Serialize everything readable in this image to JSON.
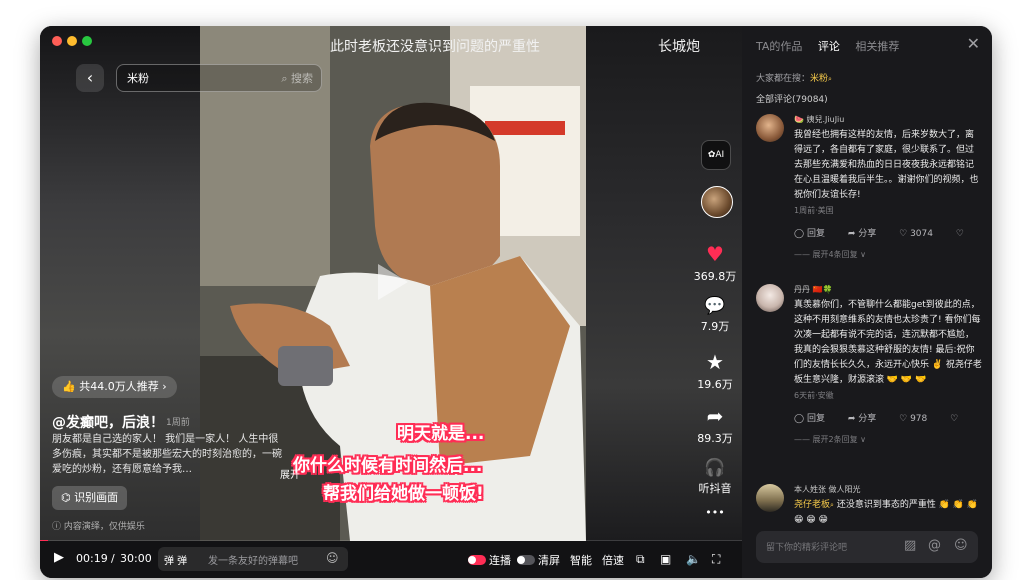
{
  "window": {
    "title": "此时老板还没意识到问题的严重性",
    "brand": "长城炮"
  },
  "search": {
    "value": "米粉",
    "button": "搜索"
  },
  "video": {
    "recommend": "共44.0万人推荐",
    "author": "@发癫吧，后浪！",
    "age": "1周前",
    "description": "朋友都是自己选的家人！ 我们是一家人！ 人生中很多伤痕，其实都不是被那些宏大的时刻治愈的，一碗爱吃的炒粉，还有愿意给予我…",
    "expand": "展开",
    "identify": "识别画面",
    "disclaimer": "内容演绎，仅供娱乐",
    "captions": [
      "明天就是...",
      "你什么时候有时间然后...",
      "帮我们给她做一顿饭!"
    ]
  },
  "actions": {
    "likes": "369.8万",
    "comments": "7.9万",
    "favorites": "19.6万",
    "shares": "89.3万",
    "listen": "听抖音",
    "more": "•••"
  },
  "controls": {
    "current_time": "00:19",
    "separator": "/",
    "duration": "30:00",
    "danmu_placeholder": "发一条友好的弹幕吧",
    "autoplay": "连播",
    "clear_screen": "清屏",
    "smart": "智能",
    "speed": "倍速",
    "progress": 0.011
  },
  "panel": {
    "tabs": [
      "TA的作品",
      "评论",
      "相关推荐"
    ],
    "active_tab": 1,
    "search_tip_prefix": "大家都在搜：",
    "search_tip_keyword": "米粉",
    "total_comments": "全部评论(79084)",
    "input_placeholder": "留下你的精彩评论吧",
    "comments": [
      {
        "name": "🍉 姨兒.JiuJiu",
        "text": "我曾经也拥有这样的友情，后来岁数大了，离得远了，各自都有了家庭，很少联系了。但过去那些充满爱和热血的日日夜夜我永远都铭记在心且温暖着我后半生。。谢谢你们的视频，也祝你们友谊长存!",
        "meta": "1周前·美国",
        "reply": "回复",
        "share": "分享",
        "likes": "3074",
        "more": "—— 展开4条回复 ∨"
      },
      {
        "name": "丹丹 🇨🇳🍀",
        "text": "真羡慕你们，不管聊什么都能get到彼此的点，这种不用刻意维系的友情也太珍贵了! 看你们每次凑一起都有说不完的话，连沉默都不尴尬，我真的会狠狠羡慕这种舒服的友情! 最后:祝你们的友情长长久久，永远开心快乐 ✌️ 祝尧仔老板生意兴隆，财源滚滚 🤝 🤝 🤝",
        "meta": "6天前·安徽",
        "reply": "回复",
        "share": "分享",
        "likes": "978",
        "more": "—— 展开2条回复 ∨"
      },
      {
        "name": "本人姓张 做人阳光",
        "keyword": "尧仔老板",
        "text": "还没意识到事态的严重性 👏 👏 👏 😁 😁 😁",
        "meta": "",
        "reply": "",
        "share": "",
        "likes": "",
        "more": ""
      }
    ]
  },
  "colors": {
    "accent": "#ff2d55",
    "keyword": "#f5c94a",
    "panel_bg": "#19191c"
  }
}
